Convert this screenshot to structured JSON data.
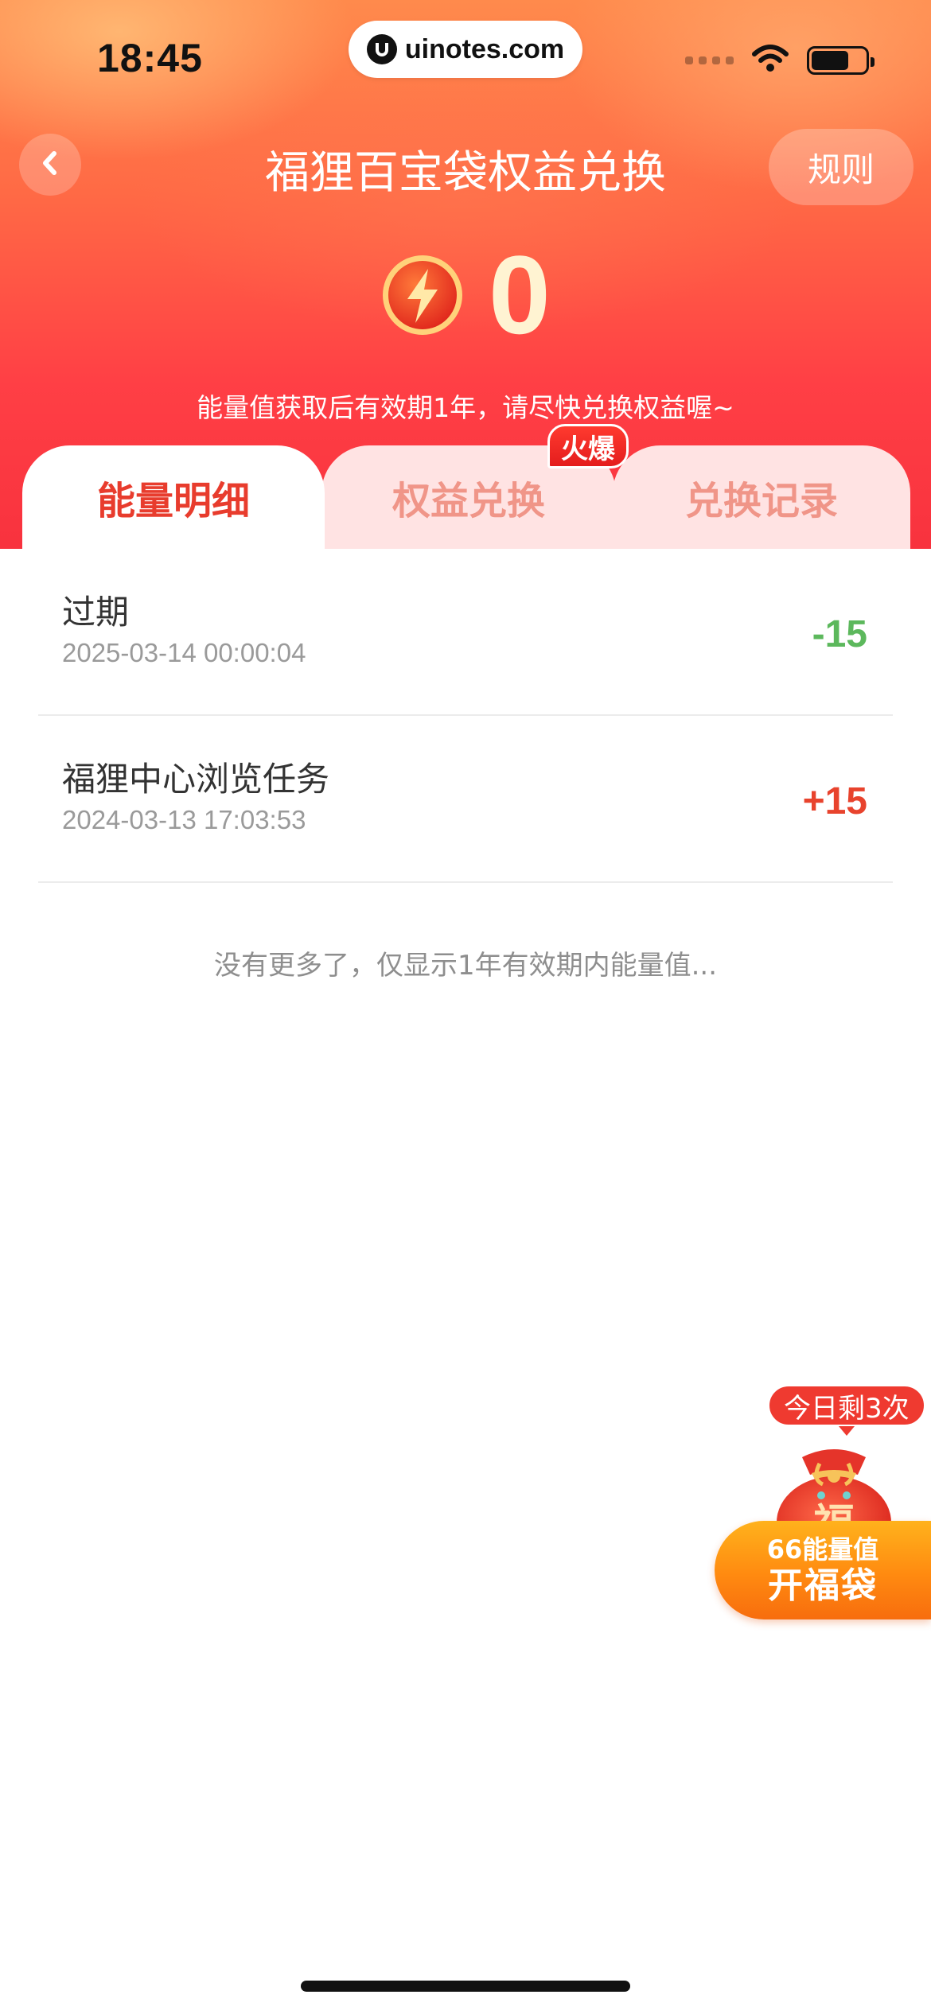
{
  "status_bar": {
    "time": "18:45",
    "watermark": "uinotes.com",
    "icons": [
      "signal-icon",
      "wifi-icon",
      "battery-icon"
    ]
  },
  "nav": {
    "title": "福狸百宝袋权益兑换",
    "back_icon": "chevron-left-icon",
    "rules_label": "规则"
  },
  "energy": {
    "icon": "lightning-icon",
    "value": "0",
    "tip": "能量值获取后有效期1年，请尽快兑换权益喔~"
  },
  "tabs": [
    {
      "label": "能量明细",
      "active": true
    },
    {
      "label": "权益兑换",
      "active": false,
      "badge": "火爆"
    },
    {
      "label": "兑换记录",
      "active": false
    }
  ],
  "records": [
    {
      "title": "过期",
      "time": "2025-03-14 00:00:04",
      "amount": "-15"
    },
    {
      "title": "福狸中心浏览任务",
      "time": "2024-03-13 17:03:53",
      "amount": "+15"
    }
  ],
  "footer_note": "没有更多了，仅显示1年有效期内能量值...",
  "lucky_bag": {
    "remaining_badge": "今日剩3次",
    "bag_char": "福",
    "cost_label": "66能量值",
    "action_label": "开福袋"
  },
  "colors": {
    "accent_red": "#e83c2d",
    "minus_green": "#5cb85c",
    "header_orange": "#ff6a45"
  }
}
